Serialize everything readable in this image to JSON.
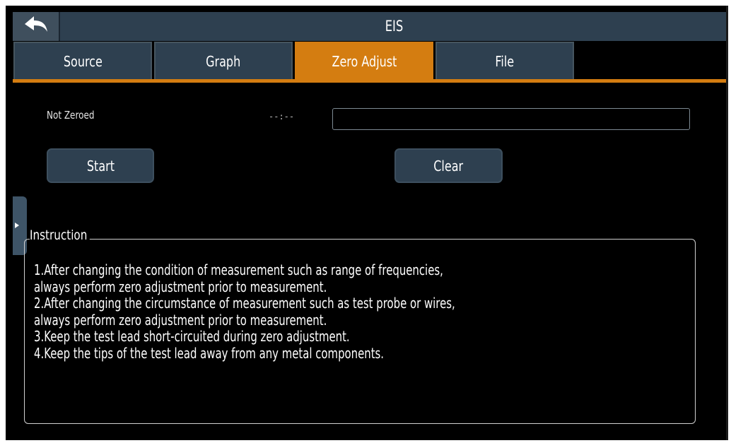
{
  "window": {
    "title": "EIS",
    "back_icon": "back-arrow-icon"
  },
  "tabs": [
    {
      "label": "Source",
      "active": false
    },
    {
      "label": "Graph",
      "active": false
    },
    {
      "label": "Zero Adjust",
      "active": true
    },
    {
      "label": "File",
      "active": false
    }
  ],
  "zero_adjust": {
    "status": "Not Zeroed",
    "elapsed": "--:--",
    "progress": 0,
    "start_label": "Start",
    "clear_label": "Clear"
  },
  "side_panel": {
    "toggle_icon": "expand-right-icon"
  },
  "instruction": {
    "title": "Instruction",
    "lines": [
      "1.After changing the condition of measurement such as range of frequencies,",
      "always perform zero adjustment prior to measurement.",
      "2.After changing the circumstance of measurement such as test probe or wires,",
      "always perform zero adjustment prior to measurement.",
      "3.Keep the test lead short-circuited during zero adjustment.",
      "4.Keep the tips of the test lead away from any metal components."
    ]
  },
  "colors": {
    "accent": "#d47d11",
    "panel": "#2e4050",
    "background": "#000000",
    "text": "#ffffff"
  }
}
